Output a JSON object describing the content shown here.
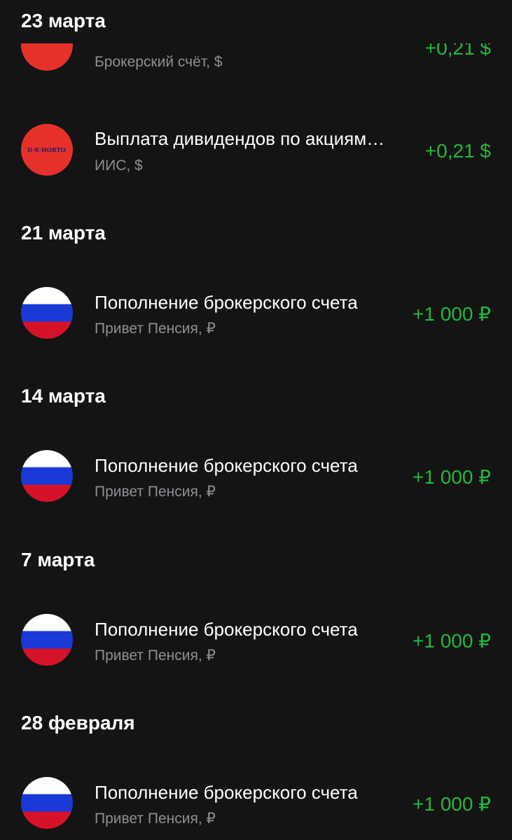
{
  "colors": {
    "background": "#141414",
    "positive_amount": "#22b83a",
    "secondary_text": "#8d8f94",
    "brand_avatar": "#e8302b"
  },
  "groups": [
    {
      "date": "23 марта",
      "operations": [
        {
          "icon": "brand-logo-icon",
          "title": "",
          "subtitle": "Брокерский счёт, $",
          "amount": "+0,21 $"
        },
        {
          "icon": "dr-horton-logo-icon",
          "logo_text": "D·R·HORTON",
          "title": "Выплата дивидендов по акциям…",
          "subtitle": "ИИС, $",
          "amount": "+0,21 $"
        }
      ]
    },
    {
      "date": "21 марта",
      "operations": [
        {
          "icon": "russia-flag-icon",
          "title": "Пополнение брокерского счета",
          "subtitle": "Привет Пенсия, ₽",
          "amount": "+1 000 ₽"
        }
      ]
    },
    {
      "date": "14 марта",
      "operations": [
        {
          "icon": "russia-flag-icon",
          "title": "Пополнение брокерского счета",
          "subtitle": "Привет Пенсия, ₽",
          "amount": "+1 000 ₽"
        }
      ]
    },
    {
      "date": "7 марта",
      "operations": [
        {
          "icon": "russia-flag-icon",
          "title": "Пополнение брокерского счета",
          "subtitle": "Привет Пенсия, ₽",
          "amount": "+1 000 ₽"
        }
      ]
    },
    {
      "date": "28 февраля",
      "operations": [
        {
          "icon": "russia-flag-icon",
          "title": "Пополнение брокерского счета",
          "subtitle": "Привет Пенсия, ₽",
          "amount": "+1 000 ₽"
        }
      ]
    }
  ]
}
